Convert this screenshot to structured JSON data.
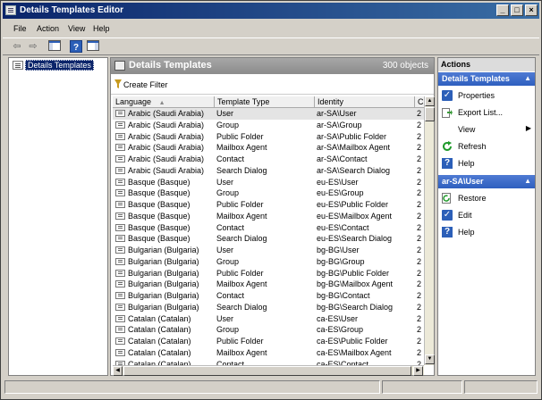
{
  "window": {
    "title": "Details Templates Editor"
  },
  "menu": [
    "File",
    "Action",
    "View",
    "Help"
  ],
  "toolbar": {
    "back": "⇦",
    "forward": "⇨"
  },
  "tree": {
    "root": "Details Templates"
  },
  "center": {
    "title": "Details Templates",
    "count": "300 objects",
    "create_filter": "Create Filter",
    "columns": [
      "Language",
      "Template Type",
      "Identity",
      "C"
    ],
    "rows": [
      {
        "language": "Arabic (Saudi Arabia)",
        "type": "User",
        "identity": "ar-SA\\User",
        "c": "2"
      },
      {
        "language": "Arabic (Saudi Arabia)",
        "type": "Group",
        "identity": "ar-SA\\Group",
        "c": "2"
      },
      {
        "language": "Arabic (Saudi Arabia)",
        "type": "Public Folder",
        "identity": "ar-SA\\Public Folder",
        "c": "2"
      },
      {
        "language": "Arabic (Saudi Arabia)",
        "type": "Mailbox Agent",
        "identity": "ar-SA\\Mailbox Agent",
        "c": "2"
      },
      {
        "language": "Arabic (Saudi Arabia)",
        "type": "Contact",
        "identity": "ar-SA\\Contact",
        "c": "2"
      },
      {
        "language": "Arabic (Saudi Arabia)",
        "type": "Search Dialog",
        "identity": "ar-SA\\Search Dialog",
        "c": "2"
      },
      {
        "language": "Basque (Basque)",
        "type": "User",
        "identity": "eu-ES\\User",
        "c": "2"
      },
      {
        "language": "Basque (Basque)",
        "type": "Group",
        "identity": "eu-ES\\Group",
        "c": "2"
      },
      {
        "language": "Basque (Basque)",
        "type": "Public Folder",
        "identity": "eu-ES\\Public Folder",
        "c": "2"
      },
      {
        "language": "Basque (Basque)",
        "type": "Mailbox Agent",
        "identity": "eu-ES\\Mailbox Agent",
        "c": "2"
      },
      {
        "language": "Basque (Basque)",
        "type": "Contact",
        "identity": "eu-ES\\Contact",
        "c": "2"
      },
      {
        "language": "Basque (Basque)",
        "type": "Search Dialog",
        "identity": "eu-ES\\Search Dialog",
        "c": "2"
      },
      {
        "language": "Bulgarian (Bulgaria)",
        "type": "User",
        "identity": "bg-BG\\User",
        "c": "2"
      },
      {
        "language": "Bulgarian (Bulgaria)",
        "type": "Group",
        "identity": "bg-BG\\Group",
        "c": "2"
      },
      {
        "language": "Bulgarian (Bulgaria)",
        "type": "Public Folder",
        "identity": "bg-BG\\Public Folder",
        "c": "2"
      },
      {
        "language": "Bulgarian (Bulgaria)",
        "type": "Mailbox Agent",
        "identity": "bg-BG\\Mailbox Agent",
        "c": "2"
      },
      {
        "language": "Bulgarian (Bulgaria)",
        "type": "Contact",
        "identity": "bg-BG\\Contact",
        "c": "2"
      },
      {
        "language": "Bulgarian (Bulgaria)",
        "type": "Search Dialog",
        "identity": "bg-BG\\Search Dialog",
        "c": "2"
      },
      {
        "language": "Catalan (Catalan)",
        "type": "User",
        "identity": "ca-ES\\User",
        "c": "2"
      },
      {
        "language": "Catalan (Catalan)",
        "type": "Group",
        "identity": "ca-ES\\Group",
        "c": "2"
      },
      {
        "language": "Catalan (Catalan)",
        "type": "Public Folder",
        "identity": "ca-ES\\Public Folder",
        "c": "2"
      },
      {
        "language": "Catalan (Catalan)",
        "type": "Mailbox Agent",
        "identity": "ca-ES\\Mailbox Agent",
        "c": "2"
      },
      {
        "language": "Catalan (Catalan)",
        "type": "Contact",
        "identity": "ca-ES\\Contact",
        "c": "2"
      }
    ]
  },
  "actions": {
    "title": "Actions",
    "section1": {
      "title": "Details Templates",
      "items": [
        {
          "label": "Properties",
          "icon": "check-icon"
        },
        {
          "label": "Export List...",
          "icon": "export-icon"
        },
        {
          "label": "View",
          "icon": "none"
        },
        {
          "label": "Refresh",
          "icon": "refresh-icon"
        },
        {
          "label": "Help",
          "icon": "help-icon"
        }
      ]
    },
    "section2": {
      "title": "ar-SA\\User",
      "items": [
        {
          "label": "Restore",
          "icon": "restore-icon"
        },
        {
          "label": "Edit",
          "icon": "check-icon"
        },
        {
          "label": "Help",
          "icon": "help-icon"
        }
      ]
    }
  },
  "colors": {
    "title_bar": "#0a246a",
    "section_header": "#2e5fbf",
    "selected_row": "#e4e4e4"
  }
}
